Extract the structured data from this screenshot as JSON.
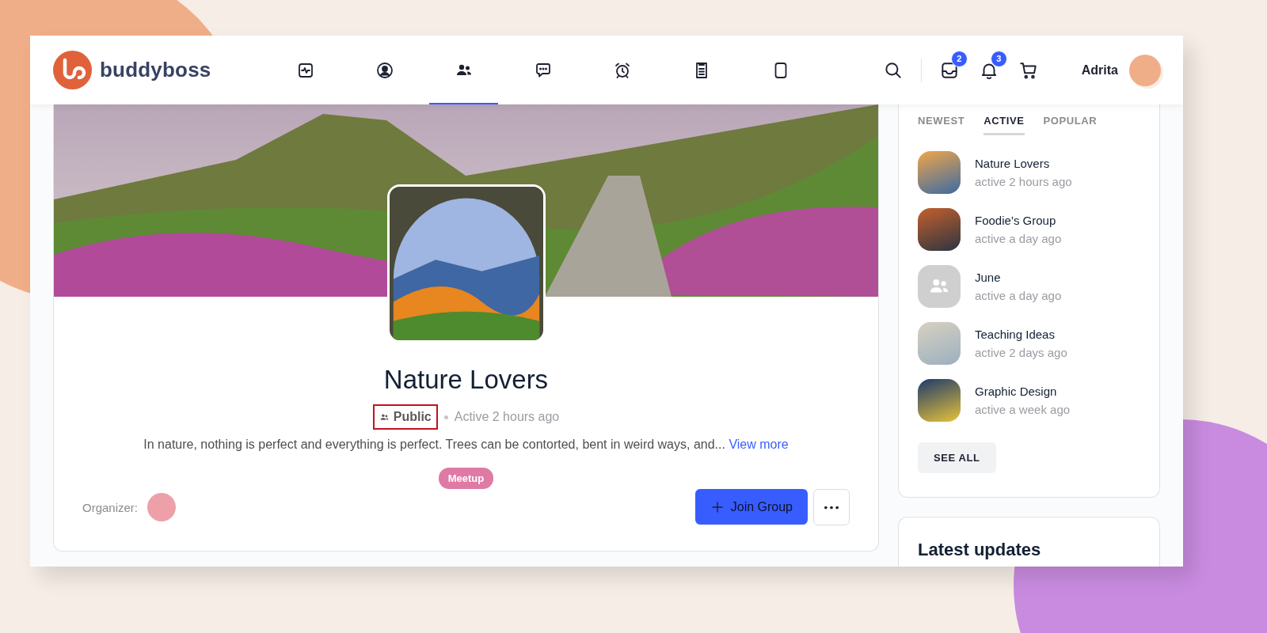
{
  "brand": {
    "name": "buddyboss"
  },
  "nav": [
    {
      "kind": "activity",
      "selected": false
    },
    {
      "kind": "profile",
      "selected": false
    },
    {
      "kind": "groups",
      "selected": true
    },
    {
      "kind": "messages",
      "selected": false
    },
    {
      "kind": "alarm",
      "selected": false
    },
    {
      "kind": "document",
      "selected": false
    },
    {
      "kind": "page",
      "selected": false
    }
  ],
  "header": {
    "actions": [
      {
        "kind": "inbox",
        "badge": "2"
      },
      {
        "kind": "bell",
        "badge": "3"
      },
      {
        "kind": "cart"
      }
    ],
    "user": {
      "name": "Adrita"
    }
  },
  "group": {
    "title": "Nature Lovers",
    "privacy": "Public",
    "privacy_highlighted": true,
    "activity": "Active 2 hours ago",
    "description": "In nature, nothing is perfect and everything is perfect. Trees can be contorted, bent in weird ways, and...",
    "view_more": "View more",
    "tag": "Meetup",
    "organizer_label": "Organizer:",
    "join_button": "Join Group"
  },
  "sidebar": {
    "tabs": [
      {
        "label": "NEWEST",
        "selected": false
      },
      {
        "label": "ACTIVE",
        "selected": true
      },
      {
        "label": "POPULAR",
        "selected": false
      }
    ],
    "groups": [
      {
        "name": "Nature Lovers",
        "activity": "active 2 hours ago",
        "kind": "photo"
      },
      {
        "name": "Foodie’s Group",
        "activity": "active a day ago",
        "kind": "photo"
      },
      {
        "name": "June",
        "activity": "active a day ago",
        "kind": "default"
      },
      {
        "name": "Teaching Ideas",
        "activity": "active 2 days ago",
        "kind": "photo"
      },
      {
        "name": "Graphic Design",
        "activity": "active a week ago",
        "kind": "photo"
      }
    ],
    "see_all": "SEE ALL"
  },
  "latest_updates": {
    "title": "Latest updates"
  }
}
